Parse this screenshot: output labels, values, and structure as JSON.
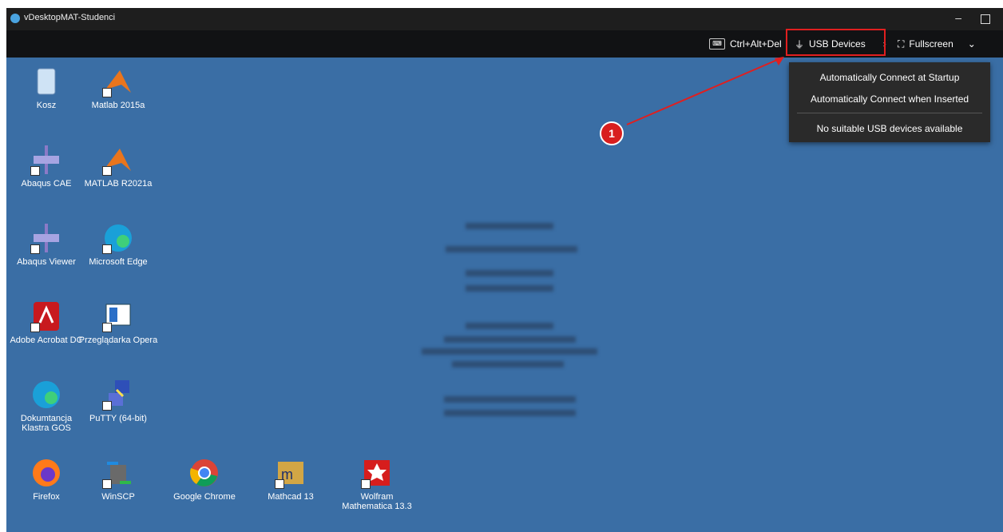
{
  "window": {
    "title": "vDesktopMAT-Studenci"
  },
  "toolbar": {
    "ctrl_alt_del": "Ctrl+Alt+Del",
    "usb_devices": "USB Devices",
    "fullscreen": "Fullscreen"
  },
  "usb_menu": {
    "items": [
      "Automatically Connect at Startup",
      "Automatically Connect when Inserted",
      "No suitable USB devices available"
    ]
  },
  "annotation": {
    "number": "1",
    "color": "#d81e1e"
  },
  "desktop": {
    "icons": [
      "Kosz",
      "Matlab 2015a",
      "Abaqus CAE",
      "MATLAB R2021a",
      "Abaqus Viewer",
      "Microsoft Edge",
      "Adobe Acrobat DC",
      "Przeglądarka Opera",
      "Dokumtancja Klastra GOS",
      "PuTTY (64-bit)",
      "Firefox",
      "WinSCP",
      "Google Chrome",
      "Mathcad 13",
      "Wolfram Mathematica 13.3"
    ]
  },
  "colors": {
    "desktop": "#3a6ea5",
    "toolbar": "#111214",
    "highlight": "#e01f1f"
  }
}
